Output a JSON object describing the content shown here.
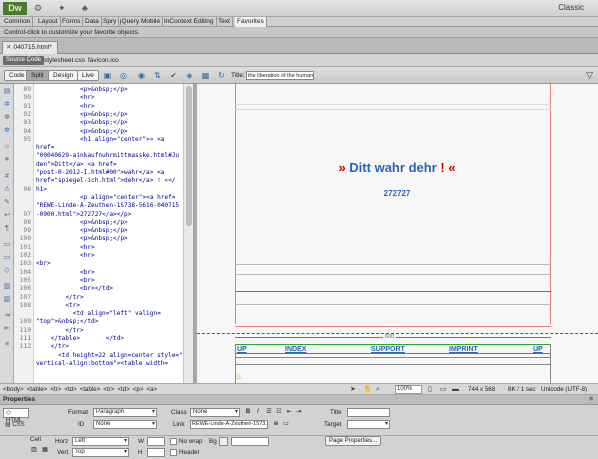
{
  "app": {
    "logo": "Dw",
    "workspace": "Classic"
  },
  "insert_tabs": [
    "Common",
    "Layout",
    "Forms",
    "Data",
    "Spry",
    "jQuery Mobile",
    "InContext Editing",
    "Text",
    "Favorites"
  ],
  "insert_hint": "Control-click to customize your favorite objects.",
  "document_tab": "040715.html*",
  "related": {
    "source_code": "Source Code",
    "files": [
      "stylesheet.css",
      "favicon.ico"
    ]
  },
  "toolbar": {
    "code": "Code",
    "split": "Split",
    "design": "Design",
    "live": "Live",
    "title_label": "Title:",
    "title_value": "the liberation of the human is"
  },
  "code_view": {
    "line_numbers": [
      "89",
      "90",
      "91",
      "92",
      "93",
      "94",
      "95",
      "",
      "",
      "",
      "",
      "",
      "96",
      "",
      "",
      "97",
      "98",
      "99",
      "100",
      "101",
      "102",
      "103",
      "104",
      "105",
      "106",
      "107",
      "108",
      "",
      "109",
      "110",
      "111",
      "112",
      ""
    ],
    "lines": [
      "            <p>&nbsp;</p>",
      "            <hr>",
      "            <hr>",
      "            <p>&nbsp;</p>",
      "            <p>&nbsp;</p>",
      "            <p>&nbsp;</p>",
      "            <h1 align=\"center\">» <a",
      "href=",
      "\"00040629-ainkaufnuhrmittmasske.html#Ju",
      "den\">Ditt</a> <a href=",
      "\"post-0-2012-I.html#00\">wahr</a> <a",
      "href=\"spiegel-ich.html\">dehr</a> ! «</",
      "h1>",
      "            <p align=\"center\"><a href=",
      "\"REWE-Linde-A-Zeuthen-15738-5616-040715",
      "-0900.html\">272727</a></p>",
      "            <p>&nbsp;</p>",
      "            <p>&nbsp;</p>",
      "            <p>&nbsp;</p>",
      "            <hr>",
      "            <hr>",
      "<br>",
      "            <br>",
      "            <br>",
      "            <br></td>",
      "        </tr>",
      "        <tr>",
      "          <td align=\"left\" valign=",
      "\"top\">&nbsp;</td>",
      "        </tr>",
      "    </table>       </td>",
      "    </tr>",
      "      <td height=22 align=center style=\"",
      "vertical-align:bottom\"><table width="
    ]
  },
  "design_view": {
    "heading_open": "»",
    "heading_words": [
      "Ditt",
      "wahr",
      "dehr"
    ],
    "heading_bang": "!",
    "heading_close": "«",
    "link_number": "272727",
    "width_label": "600",
    "nav_items": [
      "UP",
      "INDEX",
      "SUPPORT",
      "IMPRINT",
      "UP"
    ]
  },
  "status_bar": {
    "tag_selector": [
      "<body>",
      "<table>",
      "<tr>",
      "<td>",
      "<table>",
      "<tr>",
      "<td>",
      "<p>",
      "<a>"
    ],
    "zoom": "100%",
    "dimensions": "744 x 568",
    "size_time": "8K / 1 sec",
    "encoding": "Unicode (UTF-8)"
  },
  "properties": {
    "panel_title": "Properties",
    "html_btn": "HTML",
    "css_btn": "CSS",
    "format_label": "Format",
    "format_value": "Paragraph",
    "class_label": "Class",
    "class_value": "None",
    "bold": "B",
    "italic": "I",
    "title_label": "Title",
    "id_label": "ID",
    "id_value": "None",
    "link_label": "Link",
    "link_value": "REWE-Linde-A-Zeuthen-1573...",
    "target_label": "Target",
    "cell_label": "Cell",
    "horz_label": "Horz",
    "horz_value": "Left",
    "vert_label": "Vert",
    "vert_value": "Top",
    "w_label": "W",
    "h_label": "H",
    "nowrap_label": "No wrap",
    "header_label": "Header",
    "bg_label": "Bg",
    "page_properties": "Page Properties..."
  },
  "colors": {
    "heading_blue": "#2a63b8",
    "accent_red": "#cc0000",
    "guide_green": "#28a828"
  }
}
